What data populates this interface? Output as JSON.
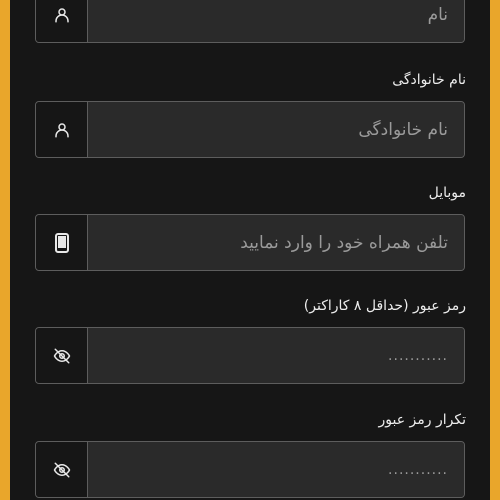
{
  "colors": {
    "accent_frame": "#e9a62b",
    "panel": "#161616",
    "input_bg": "#2a2a2a",
    "border": "#5d5d5d"
  },
  "form": {
    "first_name": {
      "placeholder": "نام",
      "icon": "user-icon"
    },
    "last_name": {
      "label": "نام خانوادگی",
      "placeholder": "نام خانوادگی",
      "icon": "user-icon"
    },
    "mobile": {
      "label": "موبایل",
      "placeholder": "تلفن همراه خود را وارد نمایید",
      "icon": "mobile-phone-icon"
    },
    "password": {
      "label": "رمز عبور (حداقل ۸ کاراکتر)",
      "placeholder": "...........",
      "icon": "eye-off-icon"
    },
    "password_confirm": {
      "label": "تکرار رمز عبور",
      "placeholder": "...........",
      "icon": "eye-off-icon"
    }
  }
}
